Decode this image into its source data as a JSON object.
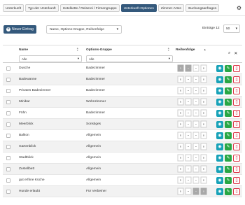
{
  "tabs": [
    {
      "label": "Unterkunft",
      "active": false
    },
    {
      "label": "Typ der Unterkunft",
      "active": false
    },
    {
      "label": "Hotelkette / Reiserei / Firmengruppe",
      "active": false
    },
    {
      "label": "Unterkunft-Optionen",
      "active": true
    },
    {
      "label": "Zimmer-Arten",
      "active": false
    },
    {
      "label": "Buchungsanfragen",
      "active": false
    }
  ],
  "toolbar": {
    "new_label": "Neuer Eintrag",
    "sort_value": "Name, Options-Gruppe, Reihenfolge",
    "entries_label": "Einträge 12",
    "entries_value": "50"
  },
  "table": {
    "columns": {
      "name": "Name",
      "group": "Options-Gruppe",
      "order": "Reihenfolge"
    },
    "filters": {
      "name": "Alle",
      "group": "Alle"
    },
    "rows": [
      {
        "name": "Dusche",
        "group": "Badezimmer"
      },
      {
        "name": "Badewanne",
        "group": "Badezimmer"
      },
      {
        "name": "Privates Badezimmer",
        "group": "Badezimmer"
      },
      {
        "name": "Minibar",
        "group": "Wohnzimmer"
      },
      {
        "name": "Föhn",
        "group": "Badezimmer"
      },
      {
        "name": "Meerblick",
        "group": "Sonstiges"
      },
      {
        "name": "Balkon",
        "group": "Allgemein"
      },
      {
        "name": "Gartenblick",
        "group": "Allgemein"
      },
      {
        "name": "Stadtblick",
        "group": "Allgemein"
      },
      {
        "name": "Zustellbett",
        "group": "Allgemein"
      },
      {
        "name": "gut erfrine Küche",
        "group": "Allgemein"
      },
      {
        "name": "Hunde erlaubt",
        "group": "Für Verbeiner"
      }
    ]
  },
  "icons": {
    "gear": "gear-icon",
    "search": "search-icon",
    "close": "close-icon",
    "view": "eye-icon",
    "edit": "pencil-icon",
    "delete": "trash-icon"
  },
  "colors": {
    "primary": "#34597c",
    "view": "#17a2b8",
    "edit": "#28a745",
    "delete": "#dc3545"
  }
}
